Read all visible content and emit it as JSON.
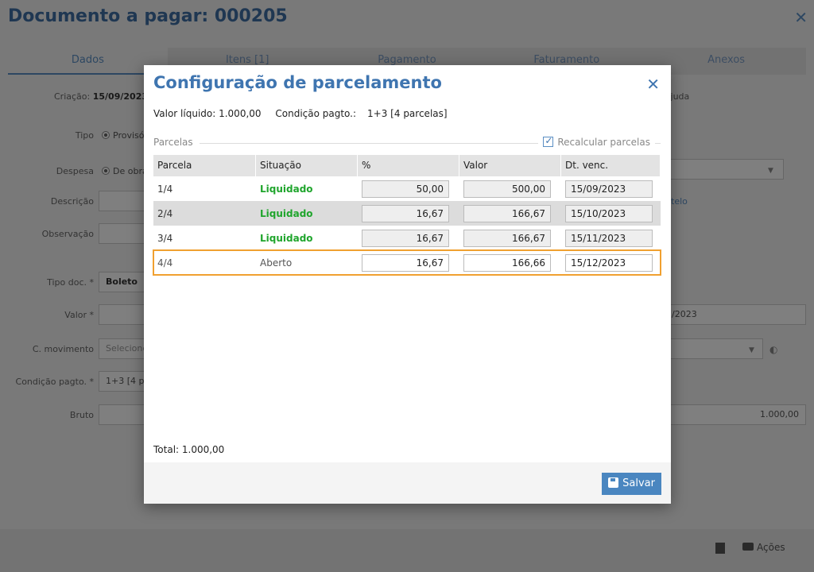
{
  "background": {
    "title": "Documento a pagar: 000205",
    "tabs": [
      "Dados",
      "Itens [1]",
      "Pagamento",
      "Faturamento",
      "Anexos"
    ],
    "criacao_label": "Criação:",
    "criacao_value": "15/09/2023",
    "ajuda": "Ajuda",
    "tipo_label": "Tipo",
    "tipo_option": "Provisório",
    "despesa_label": "Despesa",
    "despesa_option": "De obra",
    "descricao_label": "Descrição",
    "observacao_label": "Observação",
    "tipo_doc_label": "Tipo doc. *",
    "tipo_doc_value": "Boleto",
    "valor_label": "Valor *",
    "c_movimento_label": "C. movimento",
    "c_movimento_placeholder": "Selecione",
    "condicao_label": "Condição pagto. *",
    "condicao_value": "1+3 [4 parcelas]",
    "bruto_label": "Bruto",
    "bruto_value": "1.000,00",
    "date_partial": "/2023",
    "link_partial": "telo",
    "acoes": "Ações"
  },
  "modal": {
    "title": "Configuração de parcelamento",
    "valor_liquido": "Valor líquido: 1.000,00",
    "condicao_label": "Condição pagto.:",
    "condicao_value": "1+3 [4 parcelas]",
    "parcelas_legend": "Parcelas",
    "recalcular": "Recalcular parcelas",
    "columns": [
      "Parcela",
      "Situação",
      "%",
      "Valor",
      "Dt. venc."
    ],
    "rows": [
      {
        "parcela": "1/4",
        "situacao": "Liquidado",
        "pct": "50,00",
        "valor": "500,00",
        "venc": "15/09/2023"
      },
      {
        "parcela": "2/4",
        "situacao": "Liquidado",
        "pct": "16,67",
        "valor": "166,67",
        "venc": "15/10/2023"
      },
      {
        "parcela": "3/4",
        "situacao": "Liquidado",
        "pct": "16,67",
        "valor": "166,67",
        "venc": "15/11/2023"
      },
      {
        "parcela": "4/4",
        "situacao": "Aberto",
        "pct": "16,67",
        "valor": "166,66",
        "venc": "15/12/2023"
      }
    ],
    "total": "Total: 1.000,00",
    "save_label": "Salvar"
  },
  "colors": {
    "accent": "#3f75b0",
    "liquidado": "#1fa52c",
    "selection": "#f0a030",
    "button": "#4a86c0"
  }
}
